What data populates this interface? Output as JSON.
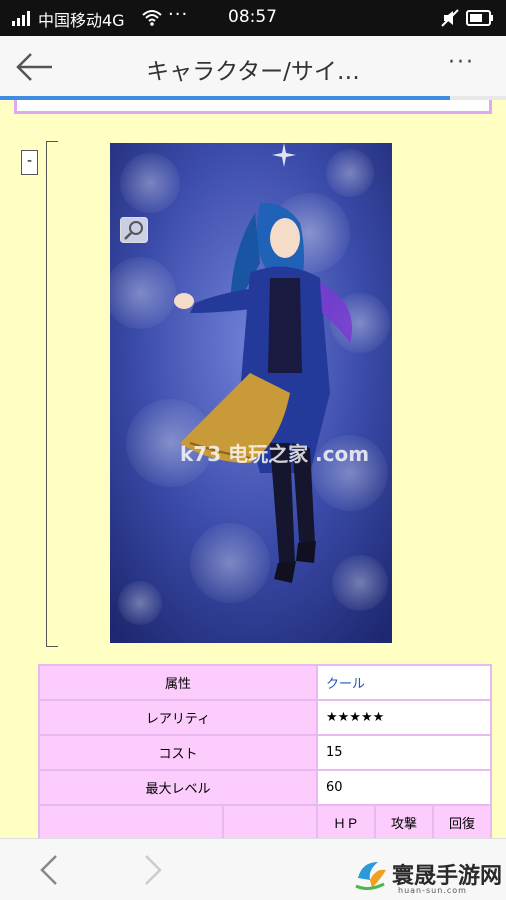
{
  "status_bar": {
    "carrier": "中国移动4G",
    "dots": "···",
    "time": "08:57"
  },
  "nav": {
    "title": "キャラクター/サイ…",
    "more": "···"
  },
  "progress": {
    "fraction": 0.89
  },
  "collapse_toggle": "-",
  "image": {
    "watermark": "k73 电玩之家 .com",
    "zoom_icon": "magnifier-icon"
  },
  "table": {
    "rows": [
      {
        "label": "属性",
        "value": "クール"
      },
      {
        "label": "レアリティ",
        "value": "★★★★★"
      },
      {
        "label": "コスト",
        "value": "15"
      },
      {
        "label": "最大レベル",
        "value": "60"
      }
    ],
    "stat_headers": [
      "ＨＰ",
      "攻撃",
      "回復"
    ]
  },
  "bottom_bar": {
    "logo_text": "寰晟手游网",
    "logo_sub": "huan-sun.com"
  },
  "colors": {
    "page_bg": "#ffffc4",
    "table_label_bg": "#fcccfc",
    "table_border": "#e8b8f0",
    "link": "#2a50c0",
    "progress": "#3f8de0"
  }
}
